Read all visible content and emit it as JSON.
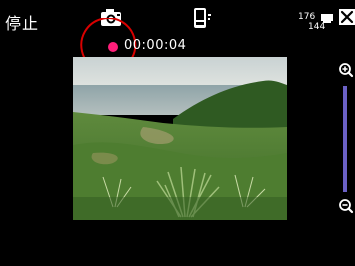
{
  "toolbar": {
    "stop_label": "停止",
    "camera_mode_icon": "camera-icon",
    "device_icon": "handheld-device-icon",
    "resolution_badge": {
      "top": "176",
      "bottom": "144"
    },
    "close_icon": "close-icon"
  },
  "recording": {
    "indicator_icon": "record-dot-icon",
    "indicator_color": "#ff1e7a",
    "highlight_color": "#d90000",
    "elapsed": "00:00:04"
  },
  "preview": {
    "scene": "landscape-camera-preview"
  },
  "zoom": {
    "in_icon": "zoom-in-icon",
    "out_icon": "zoom-out-icon",
    "track_color": "#6b61c6"
  }
}
